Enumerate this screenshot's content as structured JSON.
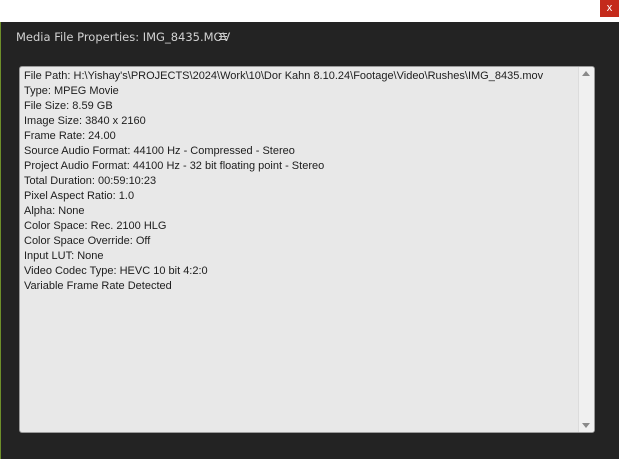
{
  "window": {
    "close_glyph": "x",
    "title": "Media File Properties: IMG_8435.MOV",
    "menu_icon": "hamburger-menu-icon"
  },
  "properties": [
    "File Path: H:\\Yishay's\\PROJECTS\\2024\\Work\\10\\Dor Kahn 8.10.24\\Footage\\Video\\Rushes\\IMG_8435.mov",
    "Type: MPEG Movie",
    "File Size: 8.59 GB",
    "Image Size: 3840 x 2160",
    "Frame Rate: 24.00",
    "Source Audio Format: 44100 Hz - Compressed - Stereo",
    "Project Audio Format: 44100 Hz - 32 bit floating point - Stereo",
    "Total Duration: 00:59:10:23",
    "Pixel Aspect Ratio: 1.0",
    "Alpha: None",
    "Color Space: Rec. 2100 HLG",
    "Color Space Override: Off",
    "Input LUT: None",
    "Video Codec Type: HEVC 10 bit  4:2:0",
    "Variable Frame Rate Detected"
  ],
  "colors": {
    "close_button": "#c42b1c",
    "panel_background": "#e8e8e8",
    "window_background": "#232323",
    "window_edge_accent": "#6e8f2a"
  }
}
